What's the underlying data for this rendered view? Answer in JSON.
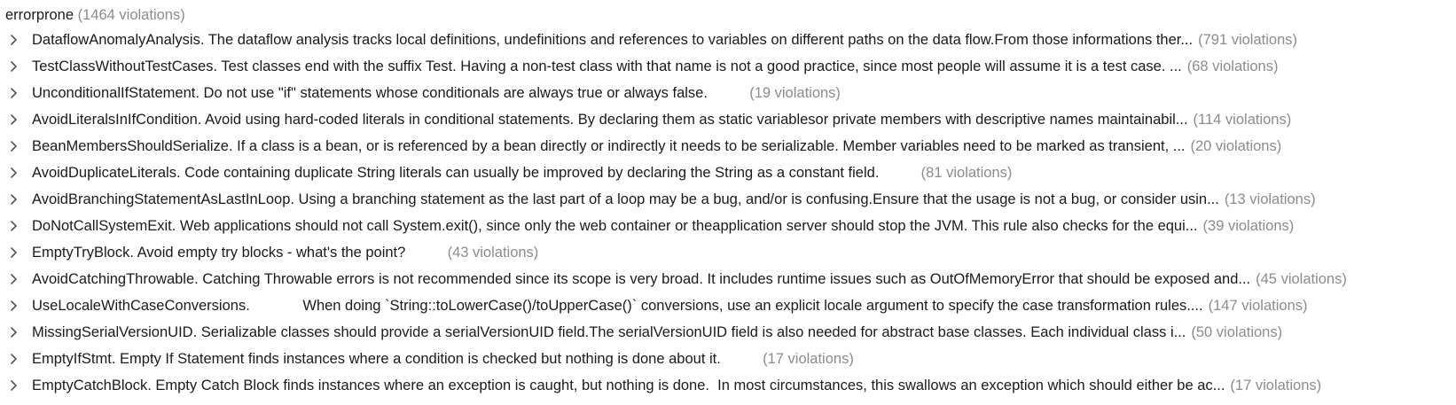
{
  "root": {
    "name": "errorprone",
    "count": "(1464 violations)"
  },
  "colors": {
    "text": "#1a1a1a",
    "muted": "#8c8c8c",
    "chevron": "#555555"
  },
  "icons": {
    "row_toggle": "chevron-right-icon"
  },
  "rules": [
    {
      "text": "DataflowAnomalyAnalysis. The dataflow analysis tracks local definitions, undefinitions and references to variables on different paths on the data flow.From those informations ther...",
      "count": "(791 violations)"
    },
    {
      "text": "TestClassWithoutTestCases. Test classes end with the suffix Test. Having a non-test class with that name is not a good practice, since most people will assume it is a test case. ...",
      "count": "(68 violations)"
    },
    {
      "text": "UnconditionalIfStatement. Do not use \"if\" statements whose conditionals are always true or always false.         ",
      "count": "(19 violations)"
    },
    {
      "text": "AvoidLiteralsInIfCondition. Avoid using hard-coded literals in conditional statements. By declaring them as static variablesor private members with descriptive names maintainabil...",
      "count": "(114 violations)"
    },
    {
      "text": "BeanMembersShouldSerialize. If a class is a bean, or is referenced by a bean directly or indirectly it needs to be serializable. Member variables need to be marked as transient, ...",
      "count": "(20 violations)"
    },
    {
      "text": "AvoidDuplicateLiterals. Code containing duplicate String literals can usually be improved by declaring the String as a constant field.         ",
      "count": "(81 violations)"
    },
    {
      "text": "AvoidBranchingStatementAsLastInLoop. Using a branching statement as the last part of a loop may be a bug, and/or is confusing.Ensure that the usage is not a bug, or consider usin...",
      "count": "(13 violations)"
    },
    {
      "text": "DoNotCallSystemExit. Web applications should not call System.exit(), since only the web container or theapplication server should stop the JVM. This rule also checks for the equi...",
      "count": "(39 violations)"
    },
    {
      "text": "EmptyTryBlock. Avoid empty try blocks - what's the point?         ",
      "count": "(43 violations)"
    },
    {
      "text": "AvoidCatchingThrowable. Catching Throwable errors is not recommended since its scope is very broad. It includes runtime issues such as OutOfMemoryError that should be exposed and...",
      "count": "(45 violations)"
    },
    {
      "text": "UseLocaleWithCaseConversions.             When doing `String::toLowerCase()/toUpperCase()` conversions, use an explicit locale argument to specify the case transformation rules....",
      "count": "(147 violations)"
    },
    {
      "text": "MissingSerialVersionUID. Serializable classes should provide a serialVersionUID field.The serialVersionUID field is also needed for abstract base classes. Each individual class i...",
      "count": "(50 violations)"
    },
    {
      "text": "EmptyIfStmt. Empty If Statement finds instances where a condition is checked but nothing is done about it.         ",
      "count": "(17 violations)"
    },
    {
      "text": "EmptyCatchBlock. Empty Catch Block finds instances where an exception is caught, but nothing is done.  In most circumstances, this swallows an exception which should either be ac...",
      "count": "(17 violations)"
    }
  ]
}
